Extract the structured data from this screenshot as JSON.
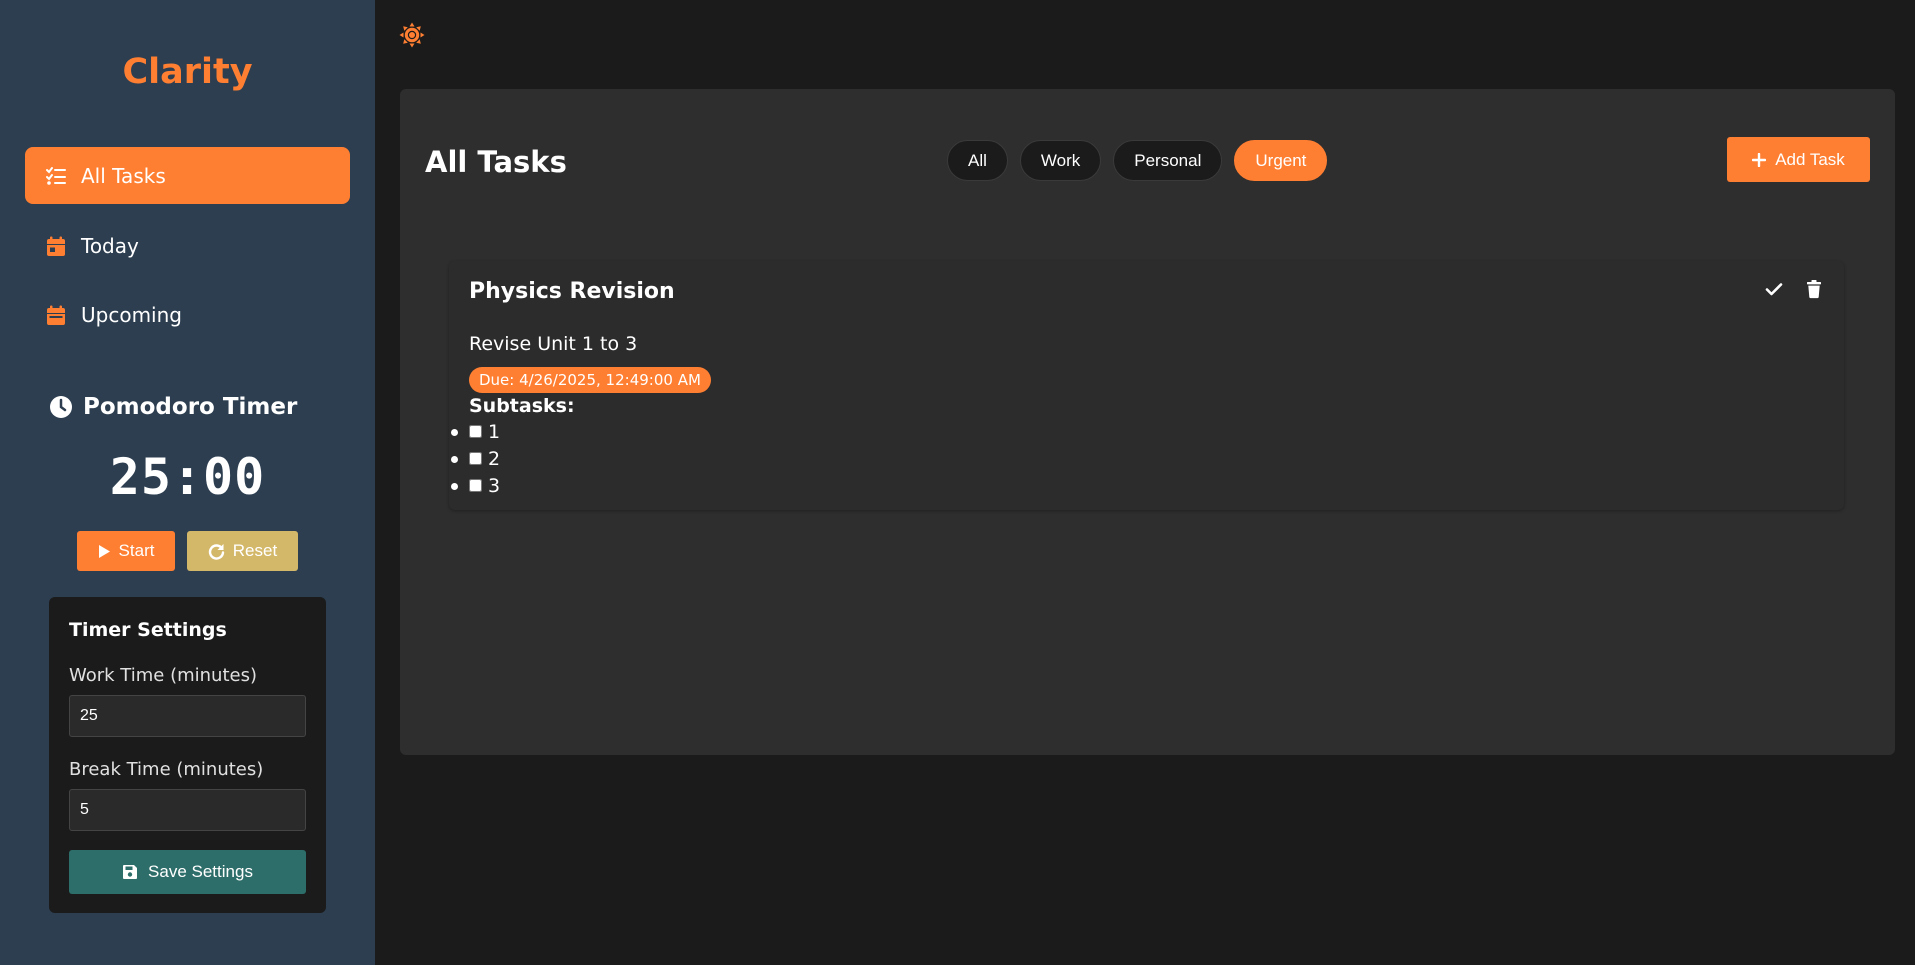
{
  "app": {
    "title": "Clarity"
  },
  "colors": {
    "accent": "#ff7f32",
    "sidebar": "#2c3e50",
    "background": "#1b1b1b",
    "card": "#2e2e2e",
    "save": "#2e6e6a",
    "reset": "#d4b86a"
  },
  "sidebar": {
    "items": [
      {
        "label": "All Tasks",
        "icon": "list-check-icon",
        "active": true
      },
      {
        "label": "Today",
        "icon": "calendar-day-icon",
        "active": false
      },
      {
        "label": "Upcoming",
        "icon": "calendar-icon",
        "active": false
      }
    ]
  },
  "pomodoro": {
    "title": "Pomodoro Timer",
    "time": "25:00",
    "start_label": "Start",
    "reset_label": "Reset"
  },
  "timer_settings": {
    "title": "Timer Settings",
    "work_label": "Work Time (minutes)",
    "work_value": "25",
    "break_label": "Break Time (minutes)",
    "break_value": "5",
    "save_label": "Save Settings"
  },
  "main": {
    "title": "All Tasks",
    "filters": [
      {
        "label": "All",
        "active": false
      },
      {
        "label": "Work",
        "active": false
      },
      {
        "label": "Personal",
        "active": false
      },
      {
        "label": "Urgent",
        "active": true
      }
    ],
    "add_label": "Add Task"
  },
  "tasks": [
    {
      "title": "Physics Revision",
      "description": "Revise Unit 1 to 3",
      "due": "Due: 4/26/2025, 12:49:00 AM",
      "subtasks_label": "Subtasks:",
      "subtasks": [
        {
          "label": "1",
          "checked": false
        },
        {
          "label": "2",
          "checked": false
        },
        {
          "label": "3",
          "checked": false
        }
      ]
    }
  ]
}
